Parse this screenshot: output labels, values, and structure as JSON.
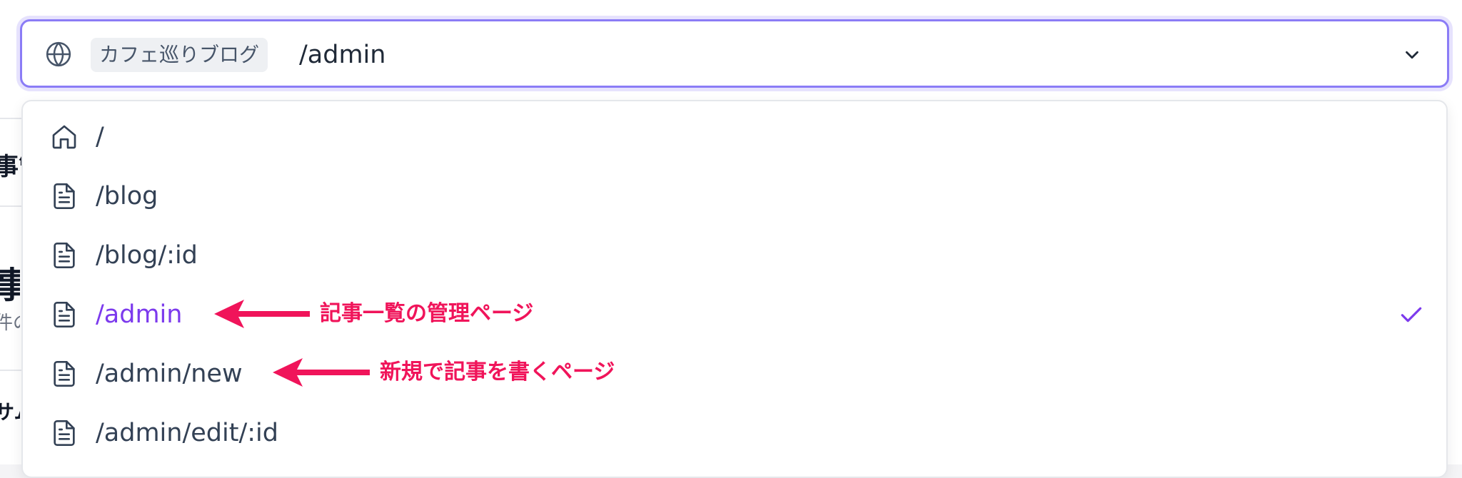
{
  "selector": {
    "site_name": "カフェ巡りブログ",
    "current_path": "/admin"
  },
  "background": {
    "fragments": [
      "事管",
      "事",
      "件の",
      "サム"
    ]
  },
  "routes": [
    {
      "path": "/",
      "icon": "home-icon",
      "selected": false
    },
    {
      "path": "/blog",
      "icon": "file-icon",
      "selected": false
    },
    {
      "path": "/blog/:id",
      "icon": "file-icon",
      "selected": false
    },
    {
      "path": "/admin",
      "icon": "file-icon",
      "selected": true
    },
    {
      "path": "/admin/new",
      "icon": "file-icon",
      "selected": false
    },
    {
      "path": "/admin/edit/:id",
      "icon": "file-icon",
      "selected": false
    }
  ],
  "annotations": [
    {
      "target": "/admin",
      "text": "記事一覧の管理ページ"
    },
    {
      "target": "/admin/new",
      "text": "新規で記事を書くページ"
    }
  ],
  "colors": {
    "accent": "#7c3aed",
    "focus_ring": "#8b7cf6",
    "annotation": "#f0145a",
    "text": "#334155"
  }
}
